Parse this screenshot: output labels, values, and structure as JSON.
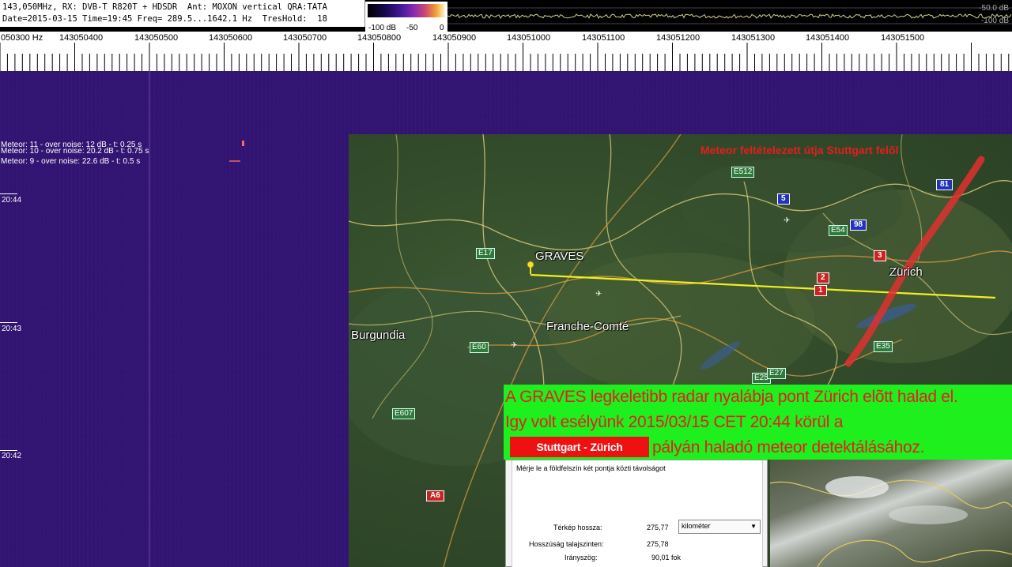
{
  "header": {
    "line1": "143,050MHz, RX: DVB-T R820T + HDSDR  Ant: MOXON vertical QRA:TATA",
    "line2": "Date=2015-03-15 Time=19:45 Freq= 289.5...1642.1 Hz  TresHold:  18"
  },
  "colorbar": {
    "labels": [
      "-100 dB",
      "-50",
      "0"
    ]
  },
  "spectrum": {
    "top_label": "-50.0 dB",
    "bottom_label": "-100 dB"
  },
  "ruler": {
    "labels": [
      "050300 Hz",
      "143050400",
      "143050500",
      "143050600",
      "143050700",
      "143050800",
      "143050900",
      "143051000",
      "143051100",
      "143051200",
      "143051300",
      "143051400",
      "143051500"
    ]
  },
  "waterfall": {
    "meteors": [
      "Meteor: 11  - over noise: 12 dB -   t: 0.25 s",
      "Meteor: 10  - over noise: 20.2 dB -   t: 0.75 s",
      "Meteor: 9  - over noise: 22.6 dB -   t: 0.5 s"
    ],
    "times": [
      "20:44",
      "20:43",
      "20:42"
    ]
  },
  "map": {
    "title": "Meteor feltételezett útja Stuttgart felől",
    "places": {
      "graves": "GRAVES",
      "zurich": "Zürich",
      "franche_comte": "Franche-Comté",
      "burgundia": "Burgundia"
    },
    "roads": {
      "e512": "E512",
      "e17": "E17",
      "e54": "E54",
      "e60": "E60",
      "e607": "E607",
      "a6": "A6",
      "e35": "E35",
      "e25": "E25",
      "e27": "E27",
      "r5": "5",
      "r81": "81",
      "r98": "98",
      "r3": "3",
      "r2": "2",
      "r1": "1"
    },
    "caption": {
      "line1": "A GRAVES legkeletibb radar nyalábja pont Zürich elõtt halad el.",
      "line2": "Igy volt esélyünk 2015/03/15 CET 20:44 körül a",
      "route_from": "Stuttgart",
      "route_sep": "-",
      "route_to": "Zürich",
      "line3": "pályán haladó meteor detektálásához."
    },
    "dialog": {
      "title": "Mérje le a földfelszín két pontja közti távolságot",
      "map_length_label": "Térkép hossza:",
      "map_length_value": "275,77",
      "unit": "kilométer",
      "ground_length_label": "Hosszúság talajszinten:",
      "ground_length_value": "275,78",
      "bearing_label": "Irányszög:",
      "bearing_value": "90,01 fok"
    }
  }
}
